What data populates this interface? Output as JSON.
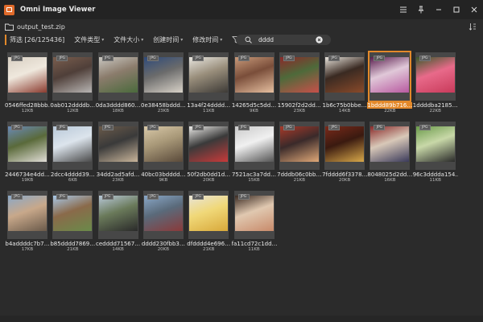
{
  "app": {
    "title": "Omni Image Viewer"
  },
  "file": {
    "name": "output_test.zip"
  },
  "filter": {
    "label": "筛选 [26/125436]",
    "dropdowns": [
      {
        "label": "文件类型"
      },
      {
        "label": "文件大小"
      },
      {
        "label": "创建时间"
      },
      {
        "label": "修改时间"
      }
    ]
  },
  "search": {
    "value": "dddd"
  },
  "accent_color": "#e3892a",
  "thumbnails": [
    {
      "badge": "JPG",
      "name": "0546ffed28bbb…",
      "size": "12KB",
      "colors": [
        "#d8cfc2",
        "#8b3b2f",
        "#efe8dd"
      ]
    },
    {
      "badge": "JPG",
      "name": "0ab012ddddb…",
      "size": "12KB",
      "colors": [
        "#7a5e4e",
        "#b8b5b3",
        "#4f3f39"
      ]
    },
    {
      "badge": "JPG",
      "name": "0da3dddd860…",
      "size": "18KB",
      "colors": [
        "#c9c7c1",
        "#4a6a3c",
        "#8b7c6c"
      ]
    },
    {
      "badge": "JPG",
      "name": "0e38458bddd…",
      "size": "23KB",
      "colors": [
        "#2e4a7a",
        "#d8d2c8",
        "#6b6b6b"
      ]
    },
    {
      "badge": "JPG",
      "name": "13a4f24dddd…",
      "size": "11KB",
      "colors": [
        "#e8e6e0",
        "#3d3a36",
        "#9a8f7c"
      ]
    },
    {
      "badge": "JPG",
      "name": "14265d5c5dd…",
      "size": "9KB",
      "colors": [
        "#c89a7a",
        "#e6bfa0",
        "#7a4e3a"
      ]
    },
    {
      "badge": "JPG",
      "name": "15902f2d2dd…",
      "size": "23KB",
      "colors": [
        "#8a2a2a",
        "#c8504a",
        "#4e6a3a"
      ]
    },
    {
      "badge": "JPG",
      "name": "1b6c75b0bbe…",
      "size": "14KB",
      "colors": [
        "#e8e4dc",
        "#8a4a2a",
        "#3a2a22"
      ]
    },
    {
      "badge": "JPG",
      "name": "1bddd89b716…",
      "size": "22KB",
      "colors": [
        "#5a1e4e",
        "#b85aa0",
        "#e0c8d8"
      ],
      "selected": true
    },
    {
      "badge": "JPG",
      "name": "1ddddba2185…",
      "size": "22KB",
      "colors": [
        "#3a5a2a",
        "#c83a5a",
        "#e86a8a"
      ]
    },
    {
      "badge": "JPG",
      "name": "2446734e4dd…",
      "size": "19KB",
      "colors": [
        "#6a8ab8",
        "#e0ddd6",
        "#5a6a3a"
      ]
    },
    {
      "badge": "JPG",
      "name": "2dcc4dddd39…",
      "size": "6KB",
      "colors": [
        "#b8c8d8",
        "#4a4a4a",
        "#dce4ec"
      ]
    },
    {
      "badge": "JPG",
      "name": "34dd2ad5afd…",
      "size": "23KB",
      "colors": [
        "#6a5a4a",
        "#c8b49a",
        "#3a3a3a"
      ]
    },
    {
      "badge": "JPG",
      "name": "40bc03bdddd…",
      "size": "9KB",
      "colors": [
        "#d8c8a8",
        "#5a4a3a",
        "#a89878"
      ]
    },
    {
      "badge": "JPG",
      "name": "50f2db0dd1d…",
      "size": "20KB",
      "colors": [
        "#ecebe8",
        "#c83a3a",
        "#3a3a3a"
      ]
    },
    {
      "badge": "JPG",
      "name": "7521ac3a7dd…",
      "size": "15KB",
      "colors": [
        "#cacaca",
        "#555555",
        "#f0f0f0"
      ]
    },
    {
      "badge": "JPG",
      "name": "7dddb06c0bb…",
      "size": "21KB",
      "colors": [
        "#a83a2a",
        "#e0a878",
        "#3a2a2a"
      ]
    },
    {
      "badge": "JPG",
      "name": "7fdddd6f3378…",
      "size": "20KB",
      "colors": [
        "#7a2a1a",
        "#d8a84a",
        "#3a1a10"
      ]
    },
    {
      "badge": "JPG",
      "name": "8048025d2dd…",
      "size": "16KB",
      "colors": [
        "#8a2a2a",
        "#3a3a5a",
        "#d8c8b8"
      ]
    },
    {
      "badge": "JPG",
      "name": "96c3dddda154…",
      "size": "11KB",
      "colors": [
        "#6a9a4a",
        "#2a2a2a",
        "#c8d8a8"
      ]
    },
    {
      "badge": "JPG",
      "name": "b4addddc7b7…",
      "size": "17KB",
      "colors": [
        "#8aa8c8",
        "#6a5a4a",
        "#c8a88a"
      ]
    },
    {
      "badge": "JPG",
      "name": "b85dddd7869…",
      "size": "21KB",
      "colors": [
        "#a8c8e8",
        "#6a8a4a",
        "#8a6a4a"
      ]
    },
    {
      "badge": "JPG",
      "name": "cedddd71567…",
      "size": "14KB",
      "colors": [
        "#b8c8d8",
        "#2a2a2a",
        "#6a7a5a"
      ]
    },
    {
      "badge": "JPG",
      "name": "dddd230fbb3…",
      "size": "20KB",
      "colors": [
        "#8aa8c8",
        "#8a3a3a",
        "#5a6a7a"
      ]
    },
    {
      "badge": "JPG",
      "name": "dfdddd4e696…",
      "size": "21KB",
      "colors": [
        "#e8e4d8",
        "#d8a83a",
        "#f0d878"
      ]
    },
    {
      "badge": "JPG",
      "name": "fa11cd72c1dd…",
      "size": "11KB",
      "colors": [
        "#3a2a22",
        "#c88a6a",
        "#e0c8b0"
      ]
    }
  ]
}
